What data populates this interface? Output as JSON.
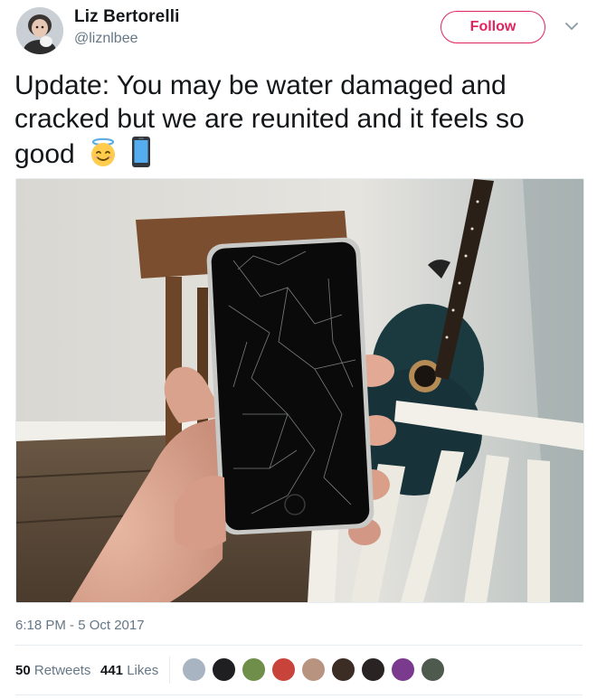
{
  "user": {
    "display_name": "Liz Bertorelli",
    "handle": "@liznlbee"
  },
  "actions": {
    "follow_label": "Follow",
    "more_icon": "chevron-down-icon"
  },
  "tweet": {
    "text": "Update: You may be water damaged and cracked but we are reunited and it feels so good",
    "emojis": [
      "smiling-face-with-halo-icon",
      "mobile-phone-icon"
    ],
    "photo_subject": "cracked-phone-photo",
    "timestamp": "6:18 PM - 5 Oct 2017"
  },
  "stats": {
    "retweets_count": "50",
    "retweets_label": "Retweets",
    "likes_count": "441",
    "likes_label": "Likes",
    "liker_avatar_count": 9
  },
  "colors": {
    "accent": "#e0245e",
    "secondary_text": "#657786",
    "divider": "#e6ecf0"
  }
}
